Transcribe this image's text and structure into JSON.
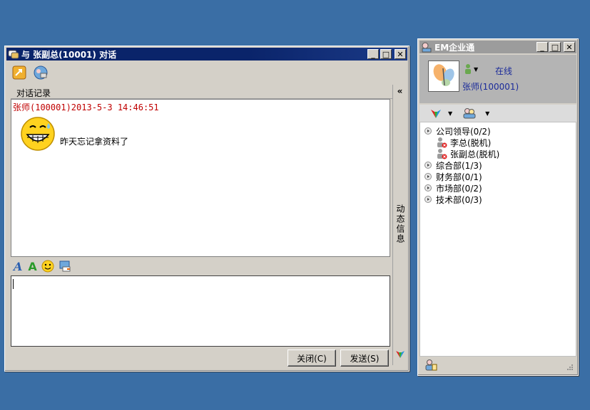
{
  "chat": {
    "title": "与 张副总(10001) 对话",
    "history_label": "对话记录",
    "message": {
      "header": "张师(100001)2013-5-3 14:46:51",
      "text": "昨天忘记拿资料了"
    },
    "side_label": "动态信息",
    "collapse": "«",
    "close_button": "关闭(C)",
    "send_button": "发送(S)",
    "input_value": ""
  },
  "contacts": {
    "title": "EM企业通",
    "status": "在线",
    "username": "张师(100001)",
    "tree": [
      {
        "label": "公司领导(0/2)",
        "children": [
          "李总(脱机)",
          "张副总(脱机)"
        ]
      },
      {
        "label": "综合部(1/3)",
        "children": []
      },
      {
        "label": "财务部(0/1)",
        "children": []
      },
      {
        "label": "市场部(0/2)",
        "children": []
      },
      {
        "label": "技术部(0/3)",
        "children": []
      }
    ]
  },
  "colors": {
    "desktop": "#3a6ea5",
    "active_title": "#0a246a",
    "inactive_title": "#9c9c9c",
    "message_header": "#c00000",
    "profile_text": "#1a2a9a"
  }
}
